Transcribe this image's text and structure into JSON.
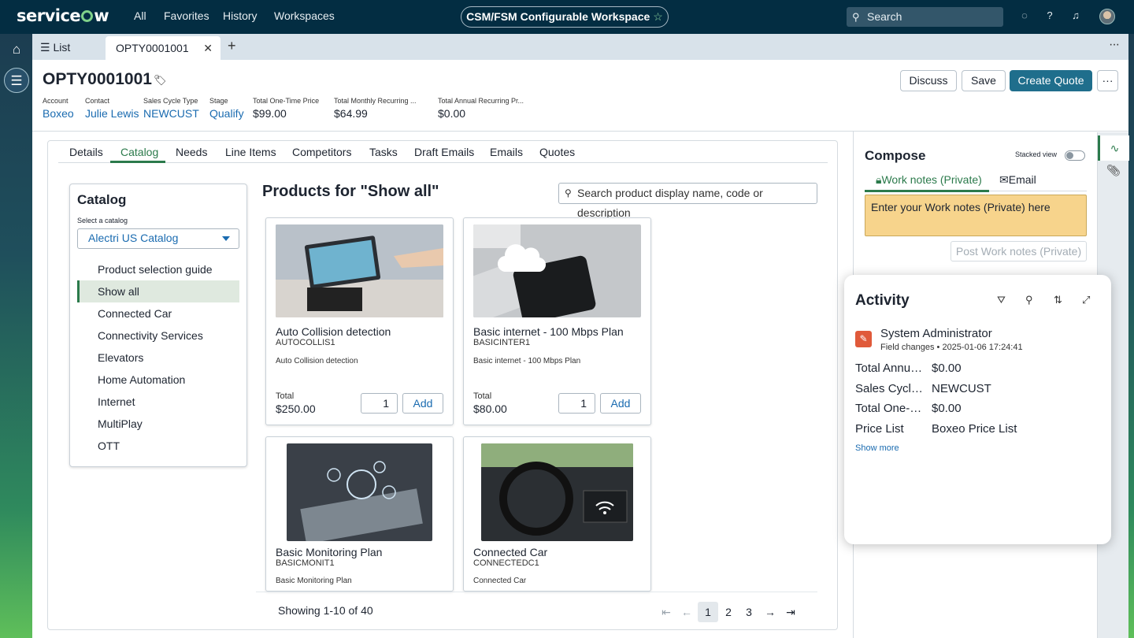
{
  "topbar": {
    "logo": "servicenow",
    "nav": [
      "All",
      "Favorites",
      "History",
      "Workspaces"
    ],
    "workspace": "CSM/FSM Configurable Workspace",
    "search_label": "Search"
  },
  "tabs": {
    "list_label": "List",
    "active_tab": "OPTY0001001"
  },
  "record": {
    "title": "OPTY0001001",
    "buttons": {
      "discuss": "Discuss",
      "save": "Save",
      "create_quote": "Create Quote"
    },
    "fields": [
      {
        "label": "Account",
        "value": "Boxeo"
      },
      {
        "label": "Contact",
        "value": "Julie Lewis"
      },
      {
        "label": "Sales Cycle Type",
        "value": "NEWCUST"
      },
      {
        "label": "Stage",
        "value": "Qualify"
      },
      {
        "label": "Total One-Time Price",
        "value": "$99.00"
      },
      {
        "label": "Total Monthly Recurring ...",
        "value": "$64.99"
      },
      {
        "label": "Total Annual Recurring Pr...",
        "value": "$0.00"
      }
    ]
  },
  "record_tabs": [
    "Details",
    "Catalog",
    "Needs",
    "Line Items",
    "Competitors",
    "Tasks",
    "Draft Emails",
    "Emails",
    "Quotes"
  ],
  "catalog": {
    "title": "Catalog",
    "select_label": "Select a catalog",
    "selected": "Alectri US Catalog",
    "items": [
      "Product selection guide",
      "Show all",
      "Connected Car",
      "Connectivity Services",
      "Elevators",
      "Home Automation",
      "Internet",
      "MultiPlay",
      "OTT"
    ]
  },
  "products": {
    "heading": "Products for \"Show all\"",
    "search_placeholder": "Search product display name, code or description",
    "total_label": "Total",
    "add_label": "Add",
    "items": [
      {
        "name": "Auto Collision detection",
        "code": "AUTOCOLLIS1",
        "desc": "Auto Collision detection",
        "total": "$250.00",
        "qty": "1"
      },
      {
        "name": "Basic internet - 100 Mbps Plan",
        "code": "BASICINTER1",
        "desc": "Basic internet - 100 Mbps Plan",
        "total": "$80.00",
        "qty": "1"
      },
      {
        "name": "Basic Monitoring Plan",
        "code": "BASICMONIT1",
        "desc": "Basic Monitoring Plan"
      },
      {
        "name": "Connected Car",
        "code": "CONNECTEDC1",
        "desc": "Connected Car"
      }
    ],
    "showing": "Showing 1-10 of 40",
    "pages": [
      "1",
      "2",
      "3"
    ]
  },
  "compose": {
    "title": "Compose",
    "stacked_view": "Stacked view",
    "tab_worknotes": "Work notes (Private)",
    "tab_email": "Email",
    "placeholder": "Enter your Work notes (Private) here",
    "post_button": "Post Work notes (Private)"
  },
  "activity": {
    "title": "Activity",
    "user": "System Administrator",
    "meta": "Field changes  •  2025-01-06 17:24:41",
    "rows": [
      {
        "key": "Total Annual...",
        "value": "$0.00"
      },
      {
        "key": "Sales Cycle ...",
        "value": "NEWCUST"
      },
      {
        "key": "Total One-Ti...",
        "value": "$0.00"
      },
      {
        "key": "Price List",
        "value": "Boxeo Price List"
      }
    ],
    "show_more": "Show more"
  },
  "colors": {
    "accent": "#2b7a4b",
    "primary_button": "#1f6e8c",
    "topbar": "#032d42",
    "link": "#1a6bb0"
  }
}
